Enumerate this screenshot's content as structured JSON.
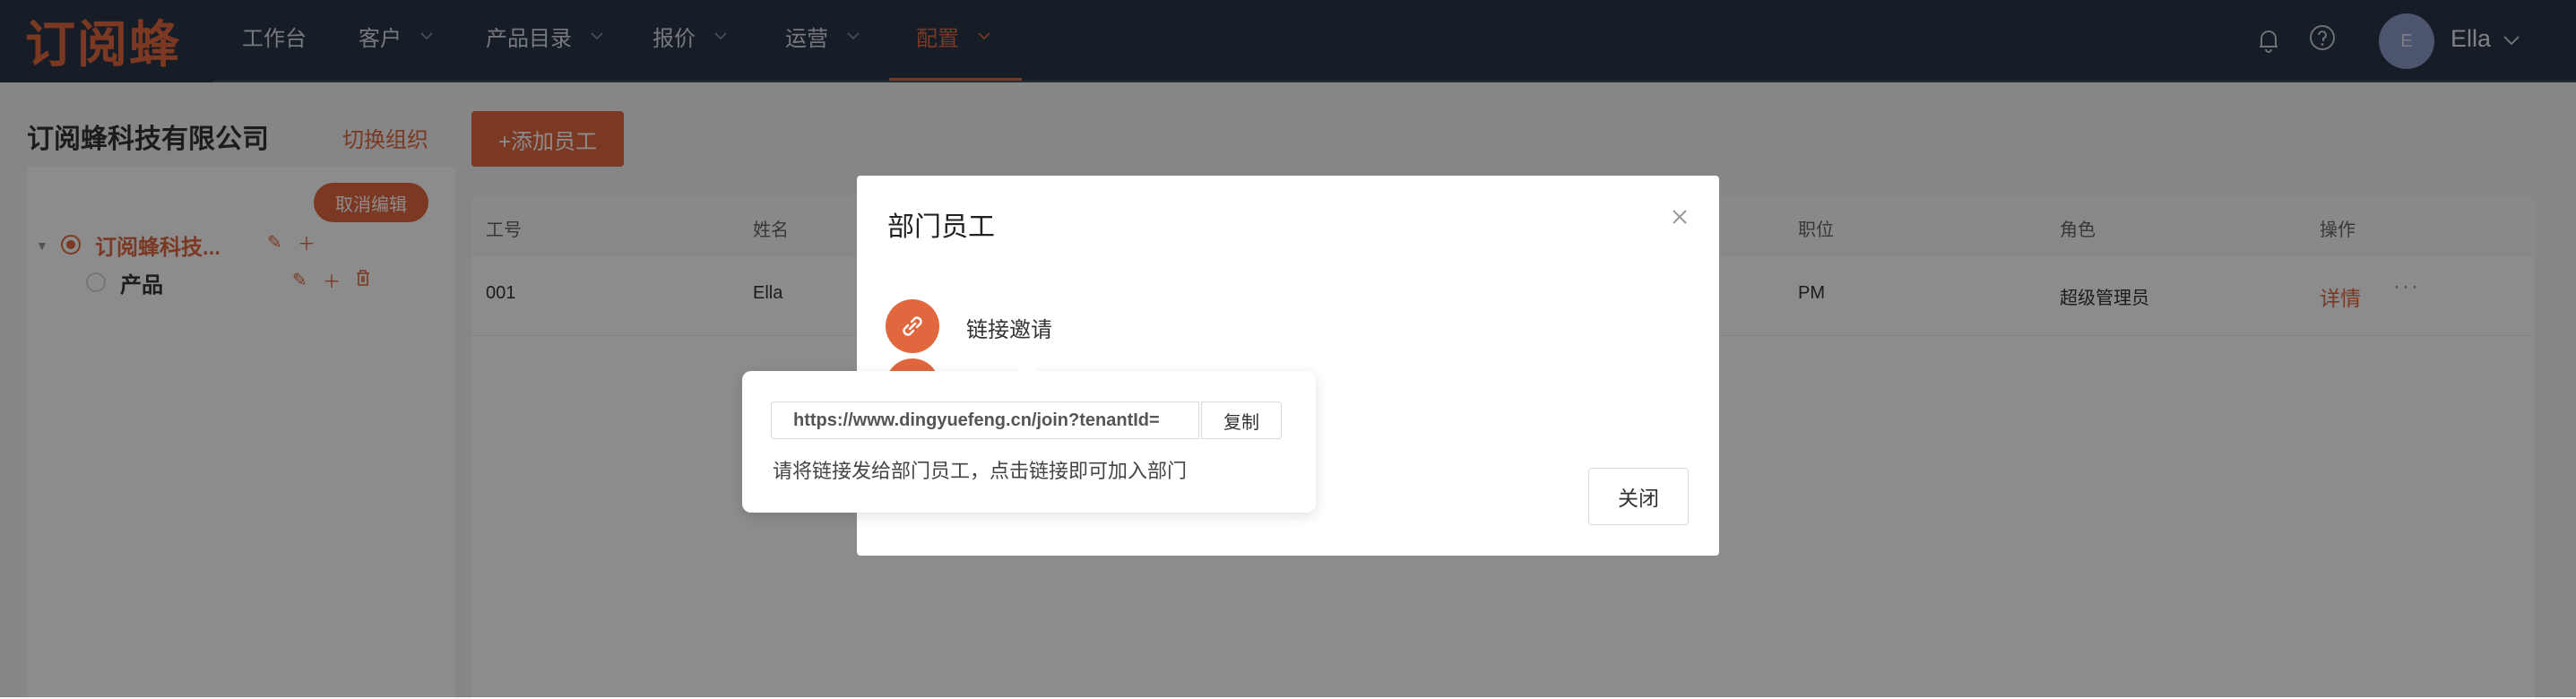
{
  "header": {
    "logo": "订阅蜂",
    "nav": [
      {
        "label": "工作台",
        "dropdown": false,
        "active": false
      },
      {
        "label": "客户",
        "dropdown": true,
        "active": false
      },
      {
        "label": "产品目录",
        "dropdown": true,
        "active": false
      },
      {
        "label": "报价",
        "dropdown": true,
        "active": false
      },
      {
        "label": "运营",
        "dropdown": true,
        "active": false
      },
      {
        "label": "配置",
        "dropdown": true,
        "active": true
      }
    ],
    "icons": [
      "bell-icon",
      "help-icon"
    ],
    "user": {
      "avatar_letter": "E",
      "name": "Ella"
    }
  },
  "org": {
    "name": "订阅蜂科技有限公司",
    "switch_label": "切换组织",
    "cancel_edit_label": "取消编辑",
    "tree": [
      {
        "label": "订阅蜂科技...",
        "selected": true
      },
      {
        "label": "产品",
        "selected": false
      }
    ]
  },
  "toolbar": {
    "add_staff_label": "+添加员工"
  },
  "table": {
    "columns": [
      "工号",
      "姓名",
      "职位",
      "角色",
      "操作"
    ],
    "rows": [
      {
        "id": "001",
        "name": "Ella",
        "position": "PM",
        "role": "超级管理员",
        "action": "详情",
        "more": "···"
      }
    ]
  },
  "modal": {
    "title": "部门员工",
    "invite_label": "链接邀请",
    "close_label": "关闭"
  },
  "popover": {
    "link": "https://www.dingyuefeng.cn/join?tenantId=",
    "copy_label": "复制",
    "hint": "请将链接发给部门员工，点击链接即可加入部门"
  },
  "colors": {
    "accent": "#e0673e",
    "topbar": "#2b3546"
  }
}
